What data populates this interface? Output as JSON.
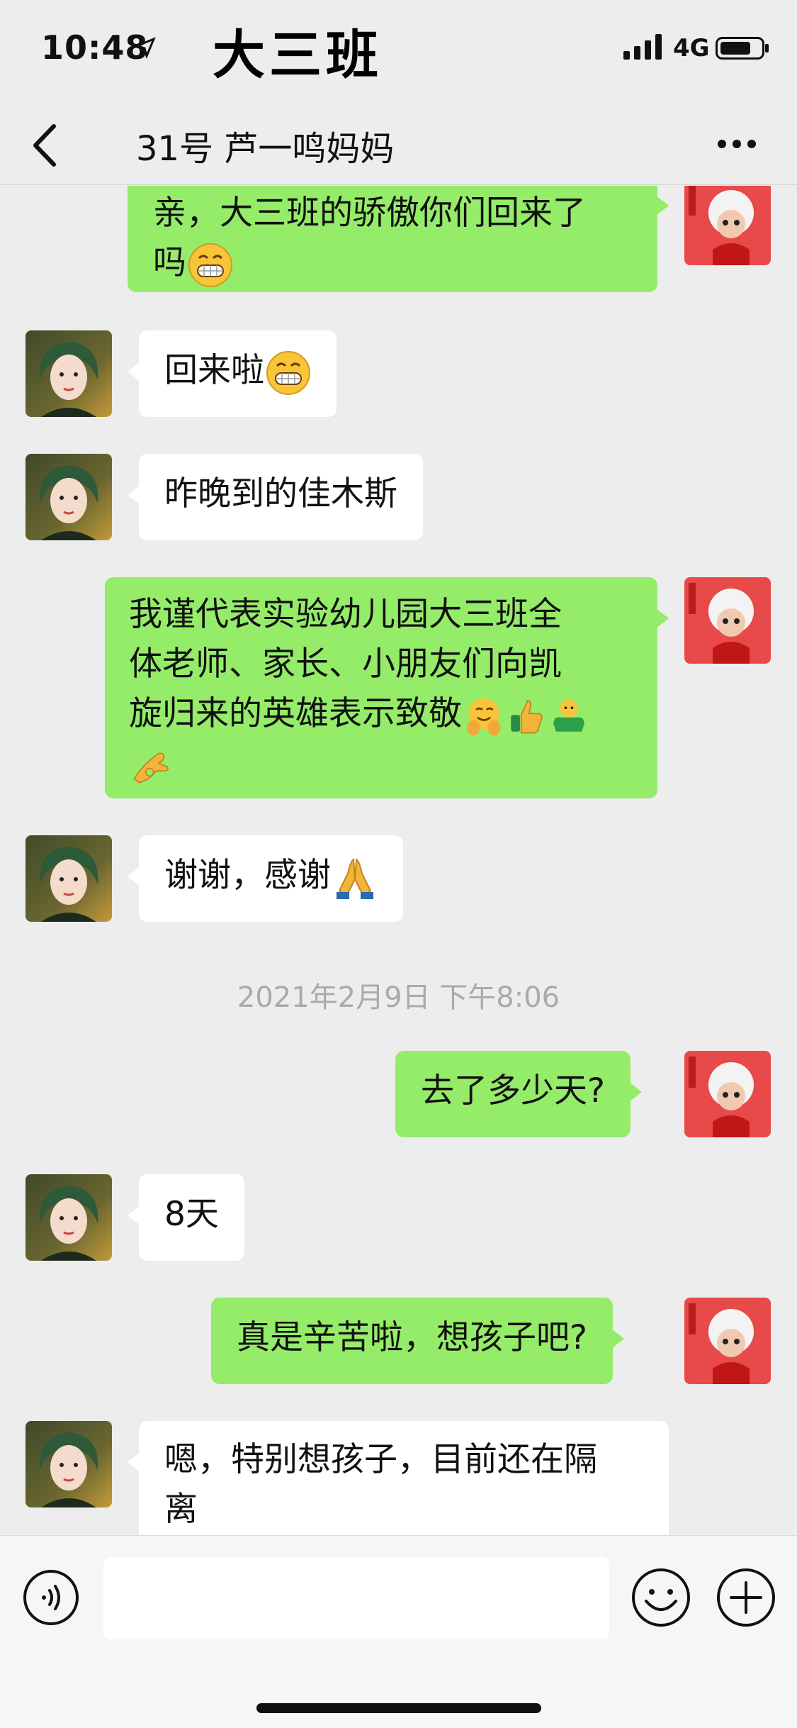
{
  "status_bar": {
    "time": "10:48",
    "network": "4G",
    "overlay_title": "大三班"
  },
  "nav": {
    "title": "31号 芦一鸣妈妈"
  },
  "messages": [
    {
      "dir": "out",
      "text": "亲，大三班的骄傲你们回来了",
      "text2": "吗",
      "emoji": "grin"
    },
    {
      "dir": "in",
      "text": "回来啦",
      "emoji": "grin"
    },
    {
      "dir": "in",
      "text": "昨晚到的佳木斯"
    },
    {
      "dir": "out",
      "line1": "我谨代表实验幼儿园大三班全",
      "line2": "体老师、家长、小朋友们向凯",
      "line3": "旋归来的英雄表示致敬",
      "emojis": [
        "hug",
        "thumbs-up",
        "strong",
        "ok"
      ]
    },
    {
      "dir": "in",
      "text": "谢谢，感谢",
      "emoji": "pray"
    },
    {
      "dir": "out",
      "text": "去了多少天?"
    },
    {
      "dir": "in",
      "text": "8天"
    },
    {
      "dir": "out",
      "text": "真是辛苦啦，想孩子吧?"
    },
    {
      "dir": "in",
      "line1": "嗯，特别想孩子，目前还在隔",
      "line2": "离"
    }
  ],
  "timestamp": "2021年2月9日 下午8:06",
  "input": {
    "placeholder": ""
  },
  "colors": {
    "background": "#ededed",
    "incoming": "#ffffff",
    "outgoing": "#95ec69"
  }
}
